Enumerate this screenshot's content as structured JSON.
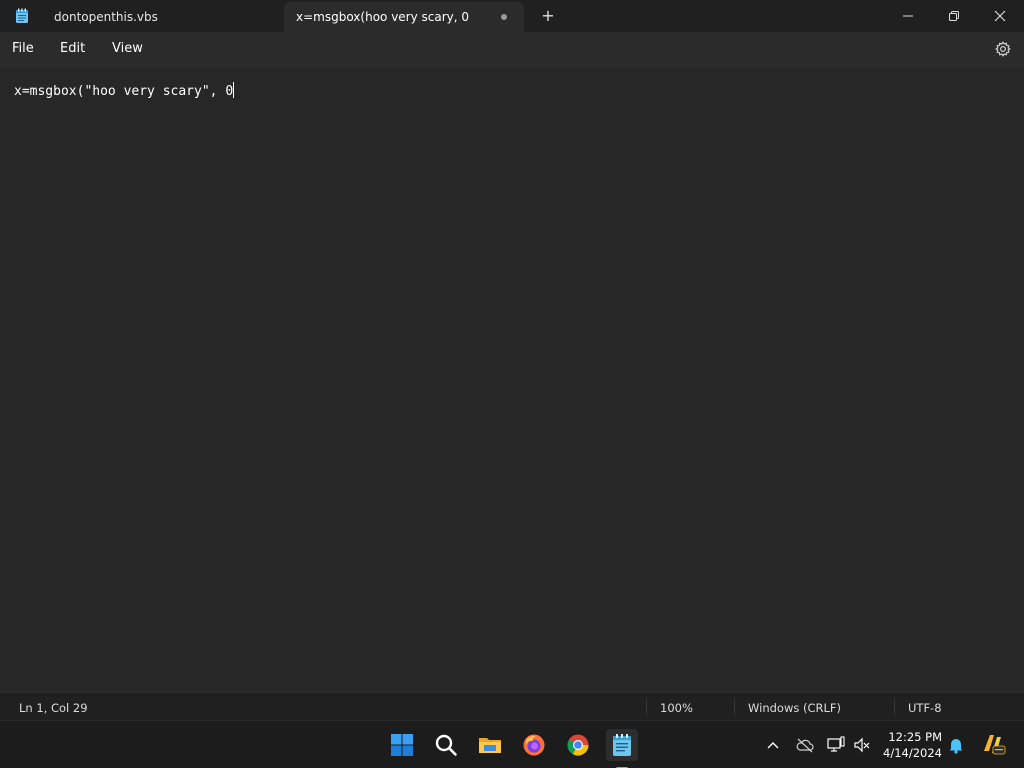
{
  "titlebar": {
    "tabs": [
      {
        "label": "dontopenthis.vbs",
        "active": false
      },
      {
        "label": "x=msgbox(hoo very scary, 0",
        "active": true,
        "unsaved": true
      }
    ],
    "new_tab_label": "+"
  },
  "menu": {
    "file": "File",
    "edit": "Edit",
    "view": "View"
  },
  "editor": {
    "content": "x=msgbox(\"hoo very scary\", 0"
  },
  "status": {
    "position": "Ln 1, Col 29",
    "zoom": "100%",
    "line_ending": "Windows (CRLF)",
    "encoding": "UTF-8"
  },
  "taskbar": {
    "apps": [
      "start-icon",
      "search-icon",
      "file-explorer-icon",
      "firefox-icon",
      "chrome-icon",
      "notepad-icon"
    ],
    "active_app": "notepad-icon"
  },
  "clock": {
    "time": "12:25 PM",
    "date": "4/14/2024"
  },
  "colors": {
    "accent": "#4cc2ff",
    "titlebar_bg": "#202020",
    "editor_bg": "#272727",
    "taskbar_bg": "#1c1c1c"
  }
}
